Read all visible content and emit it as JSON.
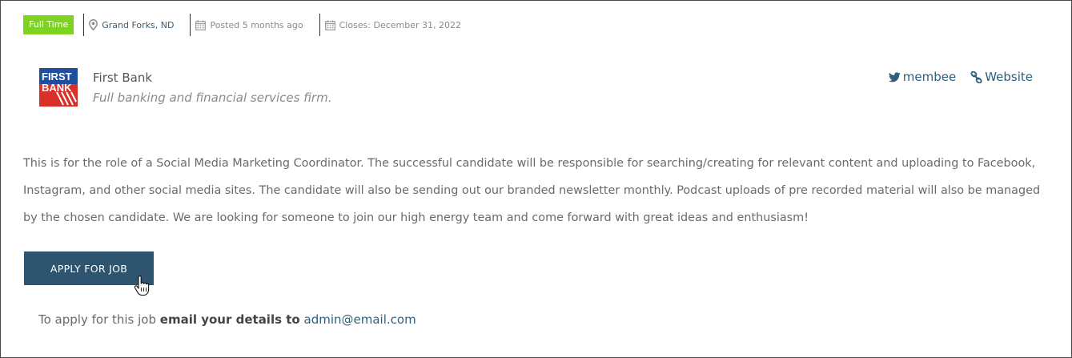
{
  "job_meta": {
    "type_badge": "Full Time",
    "location": "Grand Forks, ND",
    "posted": "Posted 5 months ago",
    "closes": "Closes: December 31, 2022"
  },
  "company": {
    "logo_text_line1": "FIRST",
    "logo_text_line2": "BANK",
    "name": "First Bank",
    "tagline": "Full banking and financial services firm."
  },
  "social": {
    "twitter_label": "membee",
    "website_label": "Website"
  },
  "description": "This is for the role of a Social Media Marketing Coordinator. The successful candidate will be responsible for searching/creating for relevant content and uploading to Facebook, Instagram, and other social media sites. The candidate will also be sending out our branded newsletter monthly. Podcast uploads of pre recorded material will also be managed by the chosen candidate. We are looking for someone to join our high energy team and come forward with great ideas and enthusiasm!",
  "apply": {
    "button_label": "APPLY FOR JOB",
    "note_prefix": "To apply for this job",
    "note_bold": "email your details to",
    "email": "admin@email.com"
  },
  "colors": {
    "badge": "#7ed321",
    "button": "#2e5470",
    "link": "#2f5f7a",
    "logo_blue": "#1f4e9c",
    "logo_red": "#d9302a"
  },
  "icons": {
    "location": "map-marker-icon",
    "posted": "calendar-icon",
    "closes": "calendar-icon",
    "twitter": "twitter-icon",
    "website": "link-icon",
    "cursor": "hand-pointer-icon"
  }
}
